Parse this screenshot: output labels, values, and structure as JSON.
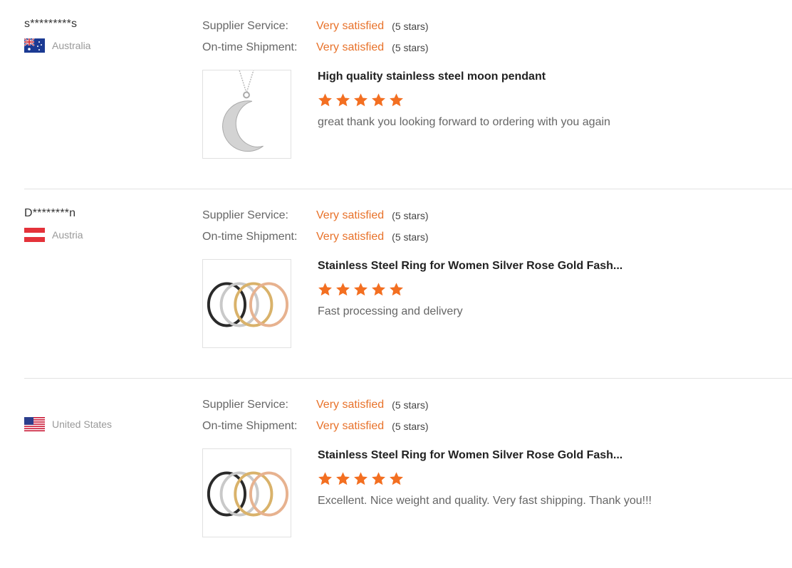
{
  "labels": {
    "supplier_service": "Supplier Service:",
    "ontime_shipment": "On-time Shipment:"
  },
  "colors": {
    "accent": "#e8722a",
    "star": "#f36f21"
  },
  "reviews": [
    {
      "buyer": "s*********s",
      "country": "Australia",
      "flag_icon": "australia-flag-icon",
      "supplier_service": {
        "value": "Very satisfied",
        "stars_text": "(5 stars)"
      },
      "ontime_shipment": {
        "value": "Very satisfied",
        "stars_text": "(5 stars)"
      },
      "product_title": "High quality stainless steel moon pendant",
      "product_image_icon": "moon-pendant-image",
      "rating": 5,
      "comment": "great thank you looking forward to ordering with you again"
    },
    {
      "buyer": "D********n",
      "country": "Austria",
      "flag_icon": "austria-flag-icon",
      "supplier_service": {
        "value": "Very satisfied",
        "stars_text": "(5 stars)"
      },
      "ontime_shipment": {
        "value": "Very satisfied",
        "stars_text": "(5 stars)"
      },
      "product_title": "Stainless Steel Ring for Women Silver Rose Gold Fash...",
      "product_image_icon": "rings-image",
      "rating": 5,
      "comment": "Fast processing and delivery"
    },
    {
      "buyer": "",
      "country": "United States",
      "flag_icon": "usa-flag-icon",
      "supplier_service": {
        "value": "Very satisfied",
        "stars_text": "(5 stars)"
      },
      "ontime_shipment": {
        "value": "Very satisfied",
        "stars_text": "(5 stars)"
      },
      "product_title": "Stainless Steel Ring for Women Silver Rose Gold Fash...",
      "product_image_icon": "rings-image",
      "rating": 5,
      "comment": "Excellent. Nice weight and quality.  Very fast shipping.  Thank you!!!"
    }
  ]
}
